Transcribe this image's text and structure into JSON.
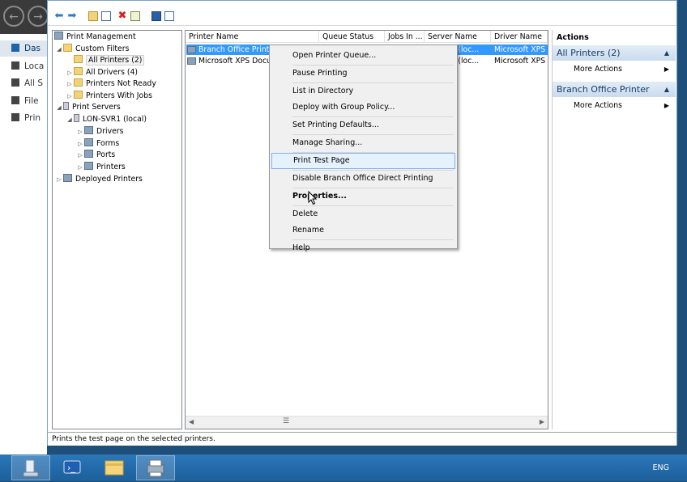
{
  "server_manager_nav": {
    "items": [
      {
        "label": "Das",
        "icon": "dashboard-icon"
      },
      {
        "label": "Loca",
        "icon": "server-icon"
      },
      {
        "label": "All S",
        "icon": "servers-icon"
      },
      {
        "label": "File",
        "icon": "file-storage-icon"
      },
      {
        "label": "Prin",
        "icon": "printer-icon"
      }
    ],
    "selected": "Das"
  },
  "tree": {
    "root": "Print Management",
    "nodes": [
      {
        "label": "Custom Filters",
        "level": 1
      },
      {
        "label": "All Printers (2)",
        "level": 2,
        "selected": true
      },
      {
        "label": "All Drivers (4)",
        "level": 2
      },
      {
        "label": "Printers Not Ready",
        "level": 2
      },
      {
        "label": "Printers With Jobs",
        "level": 2
      },
      {
        "label": "Print Servers",
        "level": 1
      },
      {
        "label": "LON-SVR1 (local)",
        "level": 2
      },
      {
        "label": "Drivers",
        "level": 3
      },
      {
        "label": "Forms",
        "level": 3
      },
      {
        "label": "Ports",
        "level": 3
      },
      {
        "label": "Printers",
        "level": 3
      },
      {
        "label": "Deployed Printers",
        "level": 1
      }
    ]
  },
  "list": {
    "columns": [
      "Printer Name",
      "Queue Status",
      "Jobs In ...",
      "Server Name",
      "Driver Name"
    ],
    "rows": [
      {
        "name": "Branch Office Printer",
        "server": "R1 (loc...",
        "driver": "Microsoft XPS D",
        "selected": true
      },
      {
        "name": "Microsoft XPS Docu",
        "server": "R1 (loc...",
        "driver": "Microsoft XPS D",
        "selected": false
      }
    ]
  },
  "actions": {
    "header": "Actions",
    "sections": [
      {
        "title": "All Printers (2)",
        "items": [
          "More Actions"
        ]
      },
      {
        "title": "Branch Office Printer",
        "items": [
          "More Actions"
        ]
      }
    ]
  },
  "context_menu": {
    "items": [
      {
        "label": "Open Printer Queue...",
        "sep_after": true
      },
      {
        "label": "Pause Printing",
        "sep_after": true
      },
      {
        "label": "List in Directory"
      },
      {
        "label": "Deploy with Group Policy...",
        "sep_after": true
      },
      {
        "label": "Set Printing Defaults...",
        "sep_after": true
      },
      {
        "label": "Manage Sharing...",
        "sep_after": true
      },
      {
        "label": "Print Test Page",
        "highlighted": true,
        "sep_after": true
      },
      {
        "label": "Disable Branch Office Direct Printing",
        "sep_after": true
      },
      {
        "label": "Properties...",
        "bold": true,
        "sep_after": true
      },
      {
        "label": "Delete"
      },
      {
        "label": "Rename",
        "sep_after": true
      },
      {
        "label": "Help"
      }
    ]
  },
  "status_bar": "Prints the test page on the selected printers.",
  "taskbar": {
    "buttons": [
      "server-manager-icon",
      "powershell-icon",
      "file-explorer-icon",
      "print-management-icon"
    ],
    "language": "ENG"
  },
  "colors": {
    "selection": "#3399ff",
    "menu_highlight": "#e5f1fb",
    "taskbar": "#2b77b8"
  }
}
